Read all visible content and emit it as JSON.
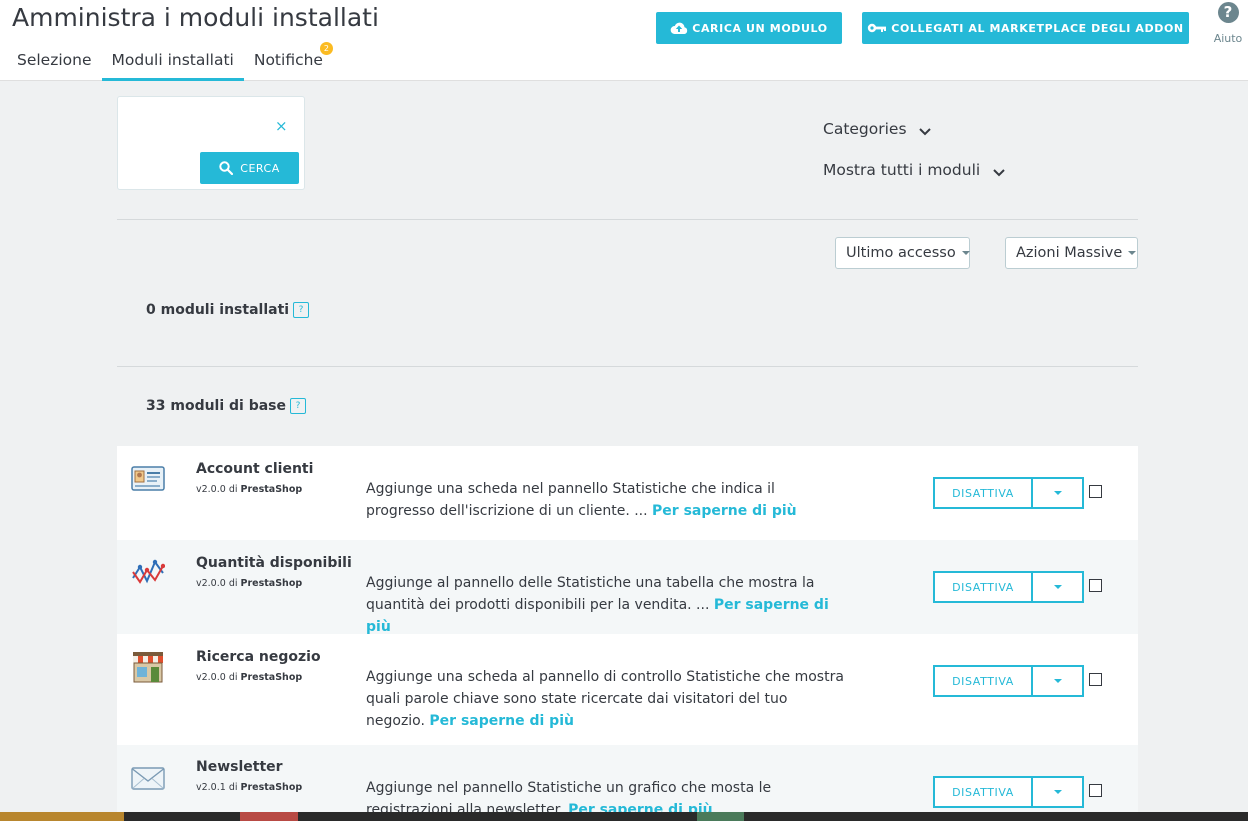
{
  "header": {
    "title": "Amministra i moduli installati",
    "tabs": [
      {
        "label": "Selezione"
      },
      {
        "label": "Moduli installati"
      },
      {
        "label": "Notifiche",
        "badge": "2"
      }
    ],
    "upload_button": "CARICA UN MODULO",
    "marketplace_button": "COLLEGATI AL MARKETPLACE DEGLI ADDON",
    "help_label": "Aiuto",
    "help_icon": "?"
  },
  "search": {
    "clear_icon": "×",
    "button_label": "CERCA"
  },
  "filters": {
    "categories": "Categories",
    "show_modules": "Mostra tutti i moduli"
  },
  "toolbar": {
    "sort_label": "Ultimo accesso",
    "bulk_label": "Azioni Massive"
  },
  "sections": {
    "installed": "0 moduli installati",
    "base": "33 moduli di base",
    "help_mark": "?"
  },
  "modules": [
    {
      "name": "Account clienti",
      "version": "v2.0.0 di",
      "author": "PrestaShop",
      "description": "Aggiunge una scheda nel pannello Statistiche che indica il progresso dell'iscrizione di un cliente. ...",
      "more": "Per saperne di più",
      "action": "DISATTIVA",
      "icon": "customer-card-icon"
    },
    {
      "name": "Quantità disponibili",
      "version": "v2.0.0 di",
      "author": "PrestaShop",
      "description": "Aggiunge al pannello delle Statistiche una tabella che mostra la quantità dei prodotti disponibili per la vendita. ...",
      "more": "Per saperne di più",
      "action": "DISATTIVA",
      "icon": "line-chart-icon"
    },
    {
      "name": "Ricerca negozio",
      "version": "v2.0.0 di",
      "author": "PrestaShop",
      "description": "Aggiunge una scheda al pannello di controllo Statistiche che mostra quali parole chiave sono state ricercate dai visitatori del tuo negozio.",
      "more": "Per saperne di più",
      "action": "DISATTIVA",
      "icon": "shop-icon"
    },
    {
      "name": "Newsletter",
      "version": "v2.0.1 di",
      "author": "PrestaShop",
      "description": "Aggiunge nel pannello Statistiche un grafico che mosta le registrazioni alla newsletter.",
      "more": "Per saperne di più",
      "action": "DISATTIVA",
      "icon": "envelope-icon"
    }
  ],
  "colors": {
    "accent": "#25b9d7",
    "badge": "#fbbb22",
    "text": "#363a41",
    "background": "#eff1f2"
  }
}
